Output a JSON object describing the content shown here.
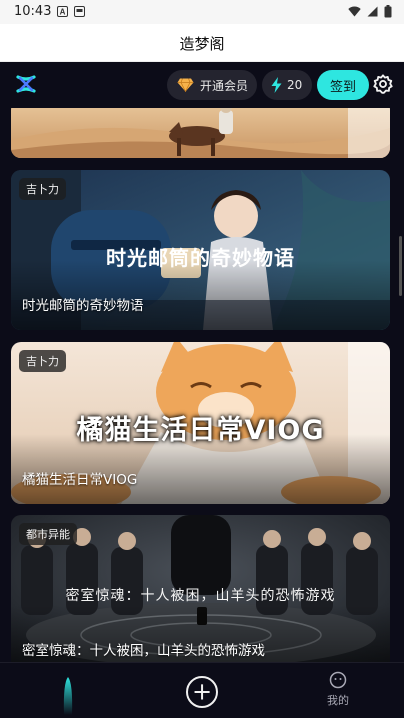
{
  "status_bar": {
    "time": "10:43"
  },
  "header": {
    "title": "造梦阁"
  },
  "topbar": {
    "vip_label": "开通会员",
    "energy_count": "20",
    "checkin_label": "签到"
  },
  "cards": [
    {
      "tag": "",
      "title": ""
    },
    {
      "tag": "吉卜力",
      "title": "时光邮筒的奇妙物语",
      "overlay": "时光邮筒的奇妙物语"
    },
    {
      "tag": "吉卜力",
      "title": "橘猫生活日常VIOG",
      "overlay": "橘猫生活日常VIOG"
    },
    {
      "tag": "都市异能",
      "title": "密室惊魂：十人被困，山羊头的恐怖游戏",
      "overlay": "密室惊魂：十人被困，山羊头的恐怖游戏"
    }
  ],
  "bottom_nav": {
    "me_label": "我的"
  },
  "colors": {
    "accent": "#2ee6e0",
    "app_bg": "#0c0c18",
    "chip_bg": "#24242f"
  },
  "icons": [
    "gem-icon",
    "lightning-icon",
    "gear-icon",
    "app-logo-icon",
    "plus-icon",
    "face-icon"
  ]
}
